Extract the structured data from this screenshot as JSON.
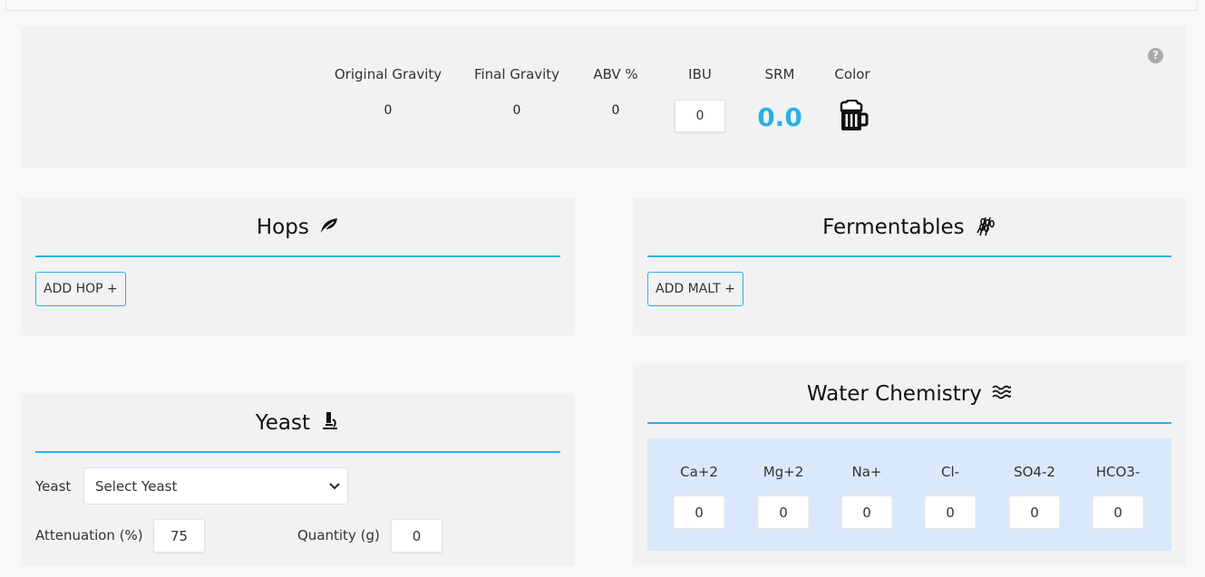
{
  "stats": {
    "help_icon": "question-circle-icon",
    "og_label": "Original Gravity",
    "fg_label": "Final Gravity",
    "abv_label": "ABV %",
    "ibu_label": "IBU",
    "srm_label": "SRM",
    "color_label": "Color",
    "og_value": "0",
    "fg_value": "0",
    "abv_value": "0",
    "ibu_value": "0",
    "srm_value": "0.0",
    "color_icon": "beer-mug-icon",
    "srm_color": "#2ab0e6"
  },
  "hops": {
    "title": "Hops",
    "icon": "leaf-icon",
    "add_label": "ADD HOP +"
  },
  "fermentables": {
    "title": "Fermentables",
    "icon": "wheat-icon",
    "add_label": "ADD MALT +"
  },
  "yeast": {
    "title": "Yeast",
    "icon": "microscope-icon",
    "yeast_label": "Yeast",
    "select_value": "Select Yeast",
    "attenuation_label": "Attenuation (%)",
    "attenuation_value": "75",
    "quantity_label": "Quantity (g)",
    "quantity_value": "0"
  },
  "water": {
    "title": "Water Chemistry",
    "icon": "water-waves-icon",
    "ions": [
      {
        "label": "Ca+2",
        "value": "0"
      },
      {
        "label": "Mg+2",
        "value": "0"
      },
      {
        "label": "Na+",
        "value": "0"
      },
      {
        "label": "Cl-",
        "value": "0"
      },
      {
        "label": "SO4-2",
        "value": "0"
      },
      {
        "label": "HCO3-",
        "value": "0"
      }
    ]
  },
  "colors": {
    "accent": "#2bb1e8",
    "panel_bg": "#f2f2f2",
    "chem_bg": "#d9e9fb"
  }
}
